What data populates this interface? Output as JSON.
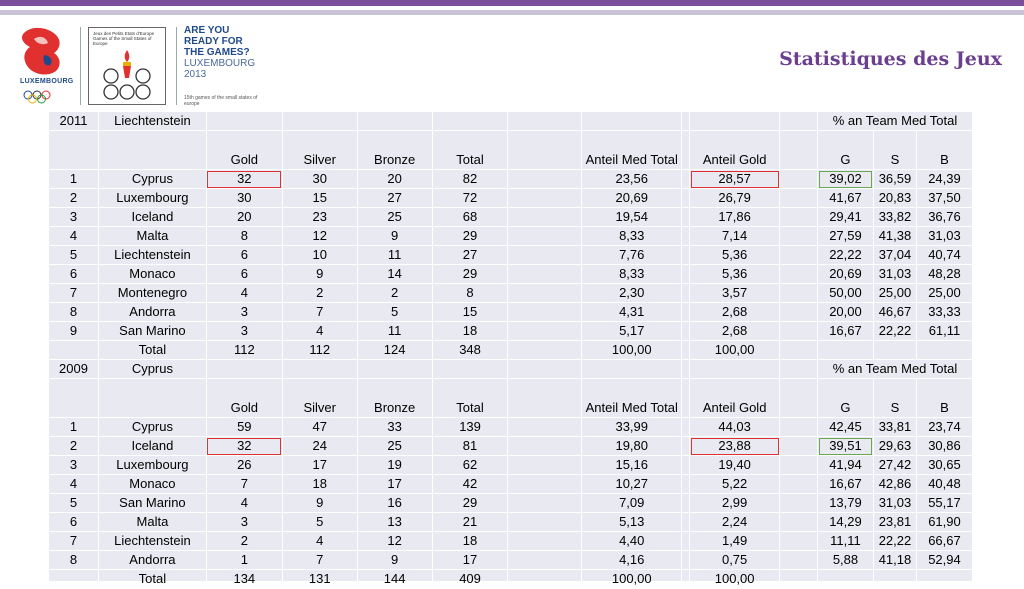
{
  "header": {
    "logo_text": "LUXEMBOURG",
    "games_logo_text": "Jeux des Petits Etats d'Europe Games of the Small States of Europe",
    "ready_lines": [
      "ARE YOU",
      "READY FOR",
      "THE GAMES?",
      "LUXEMBOURG",
      "2013"
    ],
    "ready_sub": "15th games of the small states of europe",
    "title": "Statistiques des Jeux",
    "colors": {
      "brand_purple": "#7b4f9d",
      "brand_blue": "#1f4a8a",
      "table_bg": "#e9eaf1",
      "highlight_red": "#e0302f",
      "highlight_green": "#6aa84f"
    }
  },
  "table": {
    "sections": [
      {
        "year": "2011",
        "host": "Liechtenstein",
        "pct_label": "% an Team Med Total",
        "cols": {
          "gold": "Gold",
          "silver": "Silver",
          "bronze": "Bronze",
          "total": "Total",
          "anteil_med": "Anteil Med Total",
          "anteil_gold": "Anteil Gold",
          "g": "G",
          "s": "S",
          "b": "B"
        },
        "rows": [
          {
            "rank": "1",
            "country": "Cyprus",
            "gold": "32",
            "silver": "30",
            "bronze": "20",
            "total": "82",
            "anteil_med": "23,56",
            "anteil_gold": "28,57",
            "g": "39,02",
            "s": "36,59",
            "b": "24,39"
          },
          {
            "rank": "2",
            "country": "Luxembourg",
            "gold": "30",
            "silver": "15",
            "bronze": "27",
            "total": "72",
            "anteil_med": "20,69",
            "anteil_gold": "26,79",
            "g": "41,67",
            "s": "20,83",
            "b": "37,50"
          },
          {
            "rank": "3",
            "country": "Iceland",
            "gold": "20",
            "silver": "23",
            "bronze": "25",
            "total": "68",
            "anteil_med": "19,54",
            "anteil_gold": "17,86",
            "g": "29,41",
            "s": "33,82",
            "b": "36,76"
          },
          {
            "rank": "4",
            "country": "Malta",
            "gold": "8",
            "silver": "12",
            "bronze": "9",
            "total": "29",
            "anteil_med": "8,33",
            "anteil_gold": "7,14",
            "g": "27,59",
            "s": "41,38",
            "b": "31,03"
          },
          {
            "rank": "5",
            "country": "Liechtenstein",
            "gold": "6",
            "silver": "10",
            "bronze": "11",
            "total": "27",
            "anteil_med": "7,76",
            "anteil_gold": "5,36",
            "g": "22,22",
            "s": "37,04",
            "b": "40,74"
          },
          {
            "rank": "6",
            "country": "Monaco",
            "gold": "6",
            "silver": "9",
            "bronze": "14",
            "total": "29",
            "anteil_med": "8,33",
            "anteil_gold": "5,36",
            "g": "20,69",
            "s": "31,03",
            "b": "48,28"
          },
          {
            "rank": "7",
            "country": "Montenegro",
            "gold": "4",
            "silver": "2",
            "bronze": "2",
            "total": "8",
            "anteil_med": "2,30",
            "anteil_gold": "3,57",
            "g": "50,00",
            "s": "25,00",
            "b": "25,00"
          },
          {
            "rank": "8",
            "country": "Andorra",
            "gold": "3",
            "silver": "7",
            "bronze": "5",
            "total": "15",
            "anteil_med": "4,31",
            "anteil_gold": "2,68",
            "g": "20,00",
            "s": "46,67",
            "b": "33,33"
          },
          {
            "rank": "9",
            "country": "San Marino",
            "gold": "3",
            "silver": "4",
            "bronze": "11",
            "total": "18",
            "anteil_med": "5,17",
            "anteil_gold": "2,68",
            "g": "16,67",
            "s": "22,22",
            "b": "61,11"
          }
        ],
        "total_row": {
          "label": "Total",
          "gold": "112",
          "silver": "112",
          "bronze": "124",
          "total": "348",
          "anteil_med": "100,00",
          "anteil_gold": "100,00"
        }
      },
      {
        "year": "2009",
        "host": "Cyprus",
        "pct_label": "% an Team Med Total",
        "cols": {
          "gold": "Gold",
          "silver": "Silver",
          "bronze": "Bronze",
          "total": "Total",
          "anteil_med": "Anteil Med Total",
          "anteil_gold": "Anteil Gold",
          "g": "G",
          "s": "S",
          "b": "B"
        },
        "rows": [
          {
            "rank": "1",
            "country": "Cyprus",
            "gold": "59",
            "silver": "47",
            "bronze": "33",
            "total": "139",
            "anteil_med": "33,99",
            "anteil_gold": "44,03",
            "g": "42,45",
            "s": "33,81",
            "b": "23,74"
          },
          {
            "rank": "2",
            "country": "Iceland",
            "gold": "32",
            "silver": "24",
            "bronze": "25",
            "total": "81",
            "anteil_med": "19,80",
            "anteil_gold": "23,88",
            "g": "39,51",
            "s": "29,63",
            "b": "30,86"
          },
          {
            "rank": "3",
            "country": "Luxembourg",
            "gold": "26",
            "silver": "17",
            "bronze": "19",
            "total": "62",
            "anteil_med": "15,16",
            "anteil_gold": "19,40",
            "g": "41,94",
            "s": "27,42",
            "b": "30,65"
          },
          {
            "rank": "4",
            "country": "Monaco",
            "gold": "7",
            "silver": "18",
            "bronze": "17",
            "total": "42",
            "anteil_med": "10,27",
            "anteil_gold": "5,22",
            "g": "16,67",
            "s": "42,86",
            "b": "40,48"
          },
          {
            "rank": "5",
            "country": "San Marino",
            "gold": "4",
            "silver": "9",
            "bronze": "16",
            "total": "29",
            "anteil_med": "7,09",
            "anteil_gold": "2,99",
            "g": "13,79",
            "s": "31,03",
            "b": "55,17"
          },
          {
            "rank": "6",
            "country": "Malta",
            "gold": "3",
            "silver": "5",
            "bronze": "13",
            "total": "21",
            "anteil_med": "5,13",
            "anteil_gold": "2,24",
            "g": "14,29",
            "s": "23,81",
            "b": "61,90"
          },
          {
            "rank": "7",
            "country": "Liechtenstein",
            "gold": "2",
            "silver": "4",
            "bronze": "12",
            "total": "18",
            "anteil_med": "4,40",
            "anteil_gold": "1,49",
            "g": "11,11",
            "s": "22,22",
            "b": "66,67"
          },
          {
            "rank": "8",
            "country": "Andorra",
            "gold": "1",
            "silver": "7",
            "bronze": "9",
            "total": "17",
            "anteil_med": "4,16",
            "anteil_gold": "0,75",
            "g": "5,88",
            "s": "41,18",
            "b": "52,94"
          }
        ],
        "total_row": {
          "label": "Total",
          "gold": "134",
          "silver": "131",
          "bronze": "144",
          "total": "409",
          "anteil_med": "100,00",
          "anteil_gold": "100,00"
        }
      }
    ],
    "highlights": [
      {
        "section": 0,
        "row": 0,
        "red": [
          "gold",
          "anteil_gold"
        ],
        "green": [
          "g"
        ]
      },
      {
        "section": 1,
        "row": 1,
        "red": [
          "gold",
          "anteil_gold"
        ],
        "green": [
          "g"
        ]
      }
    ]
  }
}
